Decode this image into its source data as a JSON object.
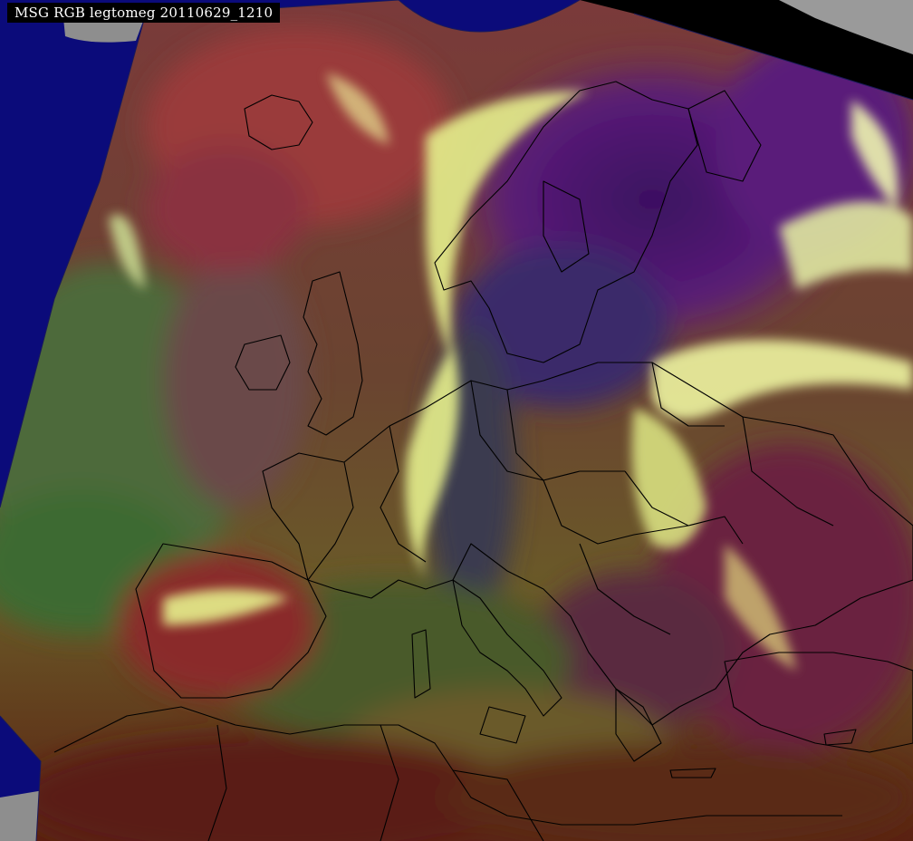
{
  "image": {
    "title": "MSG RGB legtomeg 20110629_1210"
  },
  "colors": {
    "space_background": "#0b0b7a",
    "no_data_corner": "#000000",
    "relief_gray": "#9a9a9a",
    "airmass_red": "#8a2a2a",
    "airmass_purple": "#4a1870",
    "airmass_green": "#3e6a30",
    "cloud_yellow": "#e8f08a",
    "africa_brown": "#5a1e12",
    "border_lines": "#000000"
  }
}
